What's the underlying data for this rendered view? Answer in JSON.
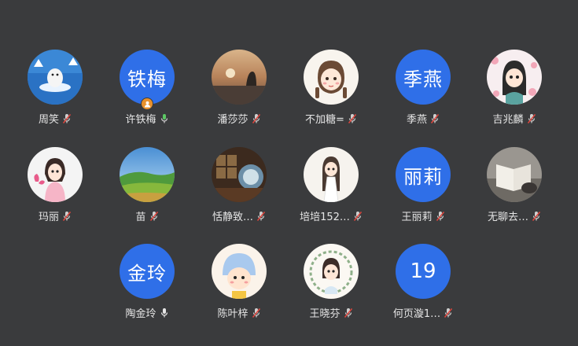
{
  "colors": {
    "background": "#3a3b3d",
    "avatar_blue": "#2f6fe8",
    "host_badge": "#e8912d",
    "mic_on": "#5cc864",
    "mic_muted_slash": "#e0463e",
    "name_text": "#e6e6e6"
  },
  "participants": [
    {
      "name": "周笑",
      "avatar": "photo-seal-on-ice",
      "mic": "muted"
    },
    {
      "name": "许铁梅",
      "avatar_text": "铁梅",
      "mic": "on",
      "host": true
    },
    {
      "name": "潘莎莎",
      "avatar": "photo-sunset-silhouette",
      "mic": "muted"
    },
    {
      "name": "不加糖=",
      "avatar": "cartoon-girl-braids",
      "mic": "muted"
    },
    {
      "name": "季燕",
      "avatar_text": "季燕",
      "mic": "muted"
    },
    {
      "name": "吉兆麟",
      "avatar": "cartoon-girl-flowers",
      "mic": "muted"
    },
    {
      "name": "玛丽",
      "avatar": "cartoon-girl-pink",
      "mic": "muted"
    },
    {
      "name": "苗",
      "avatar": "photo-green-landscape",
      "mic": "muted"
    },
    {
      "name": "恬静致…",
      "avatar": "photo-window-interior",
      "mic": "muted"
    },
    {
      "name": "培培152…",
      "avatar": "cartoon-girl-white-dress",
      "mic": "muted"
    },
    {
      "name": "王丽莉",
      "avatar_text": "丽莉",
      "mic": "muted"
    },
    {
      "name": "无聊去…",
      "avatar": "photo-book-and-cat",
      "mic": "muted"
    },
    {
      "name": "陶金玲",
      "avatar_text": "金玲",
      "mic": "on"
    },
    {
      "name": "陈叶梓",
      "avatar": "cartoon-baby-hat",
      "mic": "muted"
    },
    {
      "name": "王晓芬",
      "avatar": "cartoon-girl-wreath",
      "mic": "muted"
    },
    {
      "name": "何页漩1…",
      "avatar_text": "19",
      "mic": "muted"
    }
  ]
}
